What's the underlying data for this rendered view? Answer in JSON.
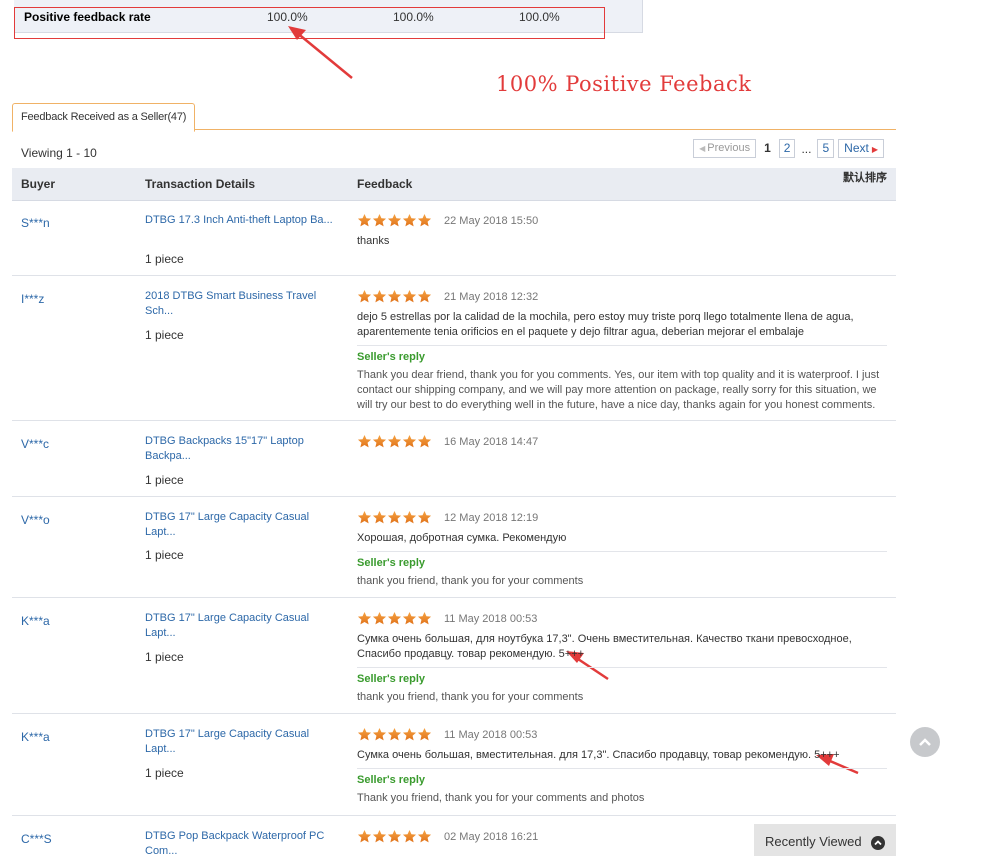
{
  "rate": {
    "label": "Positive feedback rate",
    "values": [
      "100.0%",
      "100.0%",
      "100.0%"
    ]
  },
  "annotation": {
    "title": "100% Positive Feeback"
  },
  "tab": {
    "label": "Feedback Received as a Seller(47)"
  },
  "viewing": "Viewing 1 - 10",
  "pager": {
    "previous": "Previous",
    "pages": [
      "1",
      "2",
      "...",
      "5"
    ],
    "current": "1",
    "next": "Next"
  },
  "table": {
    "headers": [
      "Buyer",
      "Transaction Details",
      "Feedback"
    ],
    "sort_label": "默认排序"
  },
  "reply_title": "Seller's reply",
  "rows": [
    {
      "buyer": "S***n",
      "product": "DTBG 17.3 Inch Anti-theft Laptop Ba...",
      "qty": "1 piece",
      "date": "22 May 2018 15:50",
      "comment": "thanks",
      "reply": ""
    },
    {
      "buyer": "I***z",
      "product": "2018 DTBG Smart Business Travel Sch...",
      "qty": "1 piece",
      "date": "21 May 2018 12:32",
      "comment": "dejo 5 estrellas por la calidad de la mochila, pero estoy muy triste porq llego totalmente llena de agua, aparentemente tenia orificios en el paquete y dejo filtrar agua, deberian mejorar el embalaje",
      "reply": "Thank you dear friend, thank you for you comments. Yes, our item with top quality and it is waterproof. I just contact our shipping company, and we will pay more attention on package, really sorry for this situation, we will try our best to do everything well in the future, have a nice day, thanks again for you honest comments."
    },
    {
      "buyer": "V***c",
      "product": "DTBG Backpacks 15\"17\" Laptop Backpa...",
      "qty": "1 piece",
      "date": "16 May 2018 14:47",
      "comment": "",
      "reply": ""
    },
    {
      "buyer": "V***o",
      "product": "DTBG 17\" Large Capacity Casual Lapt...",
      "qty": "1 piece",
      "date": "12 May 2018 12:19",
      "comment": "Хорошая, добротная сумка. Рекомендую",
      "reply": "thank you friend, thank you for your comments"
    },
    {
      "buyer": "K***a",
      "product": "DTBG 17\" Large Capacity Casual Lapt...",
      "qty": "1 piece",
      "date": "11 May 2018 00:53",
      "comment": "Сумка очень большая, для ноутбука 17,3\". Очень вместительная. Качество ткани превосходное, Спасибо продавцу. товар рекомендую. 5+++",
      "reply": "thank you friend, thank you for your comments"
    },
    {
      "buyer": "K***a",
      "product": "DTBG 17\" Large Capacity Casual Lapt...",
      "qty": "1 piece",
      "date": "11 May 2018 00:53",
      "comment": "Сумка очень большая, вместительная. для 17,3\". Спасибо продавцу, товар рекомендую. 5+++",
      "reply": "Thank you friend, thank you for your comments and photos"
    },
    {
      "buyer": "C***S",
      "product": "DTBG Pop Backpack Waterproof PC Com...",
      "qty": "",
      "date": "02 May 2018 16:21",
      "comment": "",
      "reply": ""
    }
  ],
  "recently_viewed": "Recently Viewed"
}
